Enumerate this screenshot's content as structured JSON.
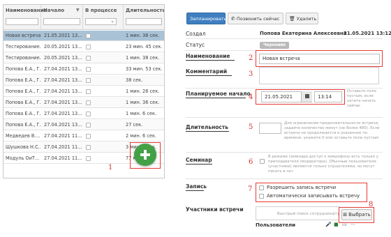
{
  "table": {
    "columns": [
      "Наименование",
      "Начало",
      "В процессе",
      "Длительность"
    ],
    "rows": [
      {
        "name": "Новая встреча",
        "start": "21.05.2021 13...",
        "duration": "1 мин. 36 сек."
      },
      {
        "name": "Тестирование...",
        "start": "20.05.2021 13...",
        "duration": "23 мин. 45 сек."
      },
      {
        "name": "Тестирование...",
        "start": "20.05.2021 13...",
        "duration": "1 мин. 38 сек."
      },
      {
        "name": "Попова Е.А., Г...",
        "start": "27.04.2021 13...",
        "duration": "33 мин. 53 сек."
      },
      {
        "name": "Попова Е.А., Г...",
        "start": "27.04.2021 13...",
        "duration": "38 сек."
      },
      {
        "name": "Попова Е.А., Г...",
        "start": "27.04.2021 13...",
        "duration": "1 мин. 26 сек."
      },
      {
        "name": "Попова Е.А., Г...",
        "start": "27.04.2021 13...",
        "duration": "1 мин. 36 сек."
      },
      {
        "name": "Попова Е.А., Г...",
        "start": "27.04.2021 13...",
        "duration": "1 мин. 6 сек."
      },
      {
        "name": "Попова Е.А., Г...",
        "start": "27.04.2021 13...",
        "duration": "27 сек."
      },
      {
        "name": "Медведев В....",
        "start": "27.04.2021 11...",
        "duration": "2 мин. 6 сек."
      },
      {
        "name": "Шушкова Н.С....",
        "start": "27.04.2021 11...",
        "duration": "3 мин. 8 сек."
      },
      {
        "name": "Модуль ОиТ...",
        "start": "27.04.2021 11...",
        "duration": "77 мин..."
      }
    ]
  },
  "toolbar": {
    "plan_label": "Запланировать",
    "call_label": "Позвонить сейчас",
    "delete_label": "Удалить"
  },
  "form": {
    "creator_label": "Создал",
    "creator_value": "Попова Екатерина Алексеевна",
    "created_date": "21.05.2021 13:12",
    "status_label": "Статус",
    "status_value": "Черновик",
    "name_label": "Наименование",
    "name_value": "Новая встреча",
    "comment_label": "Комментарий",
    "planned_start_label": "Планируемое начало",
    "date_value": "21.05.2021",
    "time_value": "13:14",
    "planned_start_hint": "Оставьте поле пустым, если хотите начать сейчас",
    "duration_label": "Длительность",
    "duration_hint": "Для ограничения продолжительности встречи, задайте количество минут (не более 480). Если встреча не продолжается в указанное по времени, укажите 0 или оставьте поле пустым",
    "seminar_label": "Семинар",
    "seminar_hint": "В режиме семинара доступ к микрофону есть только у преподавателя (модератора). Обычные пользователи (участники) являются только слушателями, но могут писать в чат",
    "record_label": "Запись",
    "allow_record_label": "Разрешить запись встречи",
    "auto_record_label": "Автоматически записывать встречу",
    "participants_label": "Участники встречи",
    "search_placeholder": "Быстрый поиск сотрудника/группы",
    "select_label": "Выбрать",
    "users_label": "Пользователи"
  },
  "markers": [
    "1",
    "2",
    "3",
    "4",
    "5",
    "6",
    "7",
    "8"
  ],
  "colors": {
    "accent": "#3f7fc0",
    "selected_row": "#a9c2d6",
    "highlight_frame": "#e53935",
    "fab": "#43a047",
    "marker_text": "#d32f2f"
  }
}
